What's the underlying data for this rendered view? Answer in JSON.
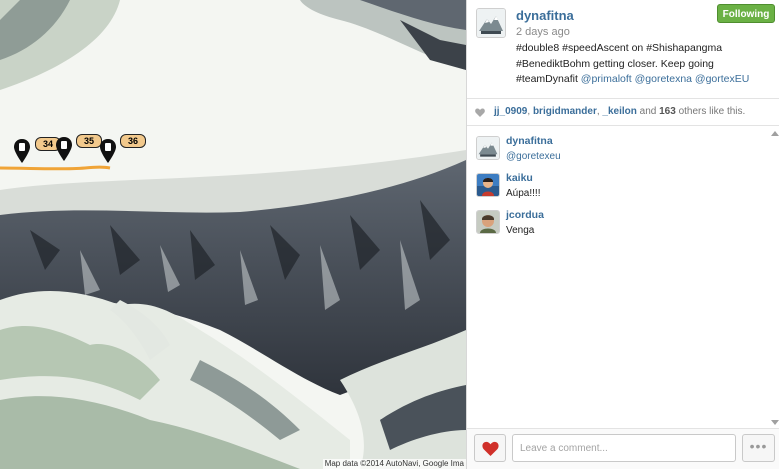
{
  "map": {
    "waypoints": [
      {
        "label": "34"
      },
      {
        "label": "35"
      },
      {
        "label": "36"
      }
    ],
    "attribution": "Map data ©2014 AutoNavi, Google Ima",
    "colors": {
      "snow": "#f4f6f2",
      "rock": "#2e333b",
      "track": "#f0a437",
      "pin": "#111111"
    }
  },
  "post": {
    "username": "dynafitna",
    "time_ago": "2 days ago",
    "follow_label": "Following",
    "caption_text": "#double8 #speedAscent on #Shishapangma #BenediktBohm getting closer. Keep going #teamDynafit",
    "caption_mentions": "@primaloft @goretexna @gortexEU",
    "avatar_icon": "dynafit-avatar"
  },
  "likes": {
    "icon": "heart-icon",
    "users": [
      "jj_0909",
      "brigidmander",
      "_keilon"
    ],
    "connector": "and",
    "count": "163",
    "suffix": "others like this."
  },
  "comments": [
    {
      "user": "dynafitna",
      "text": "@goretexeu",
      "is_mention": true
    },
    {
      "user": "kaiku",
      "text": "Aúpa!!!!",
      "is_mention": false
    },
    {
      "user": "jcordua",
      "text": "Venga",
      "is_mention": false
    }
  ],
  "comment_bar": {
    "placeholder": "Leave a comment...",
    "like_icon": "heart-icon",
    "more_label": "•••"
  },
  "colors": {
    "link": "#3b6e9a",
    "follow_green": "#6bb145",
    "like_red": "#d0302a"
  }
}
